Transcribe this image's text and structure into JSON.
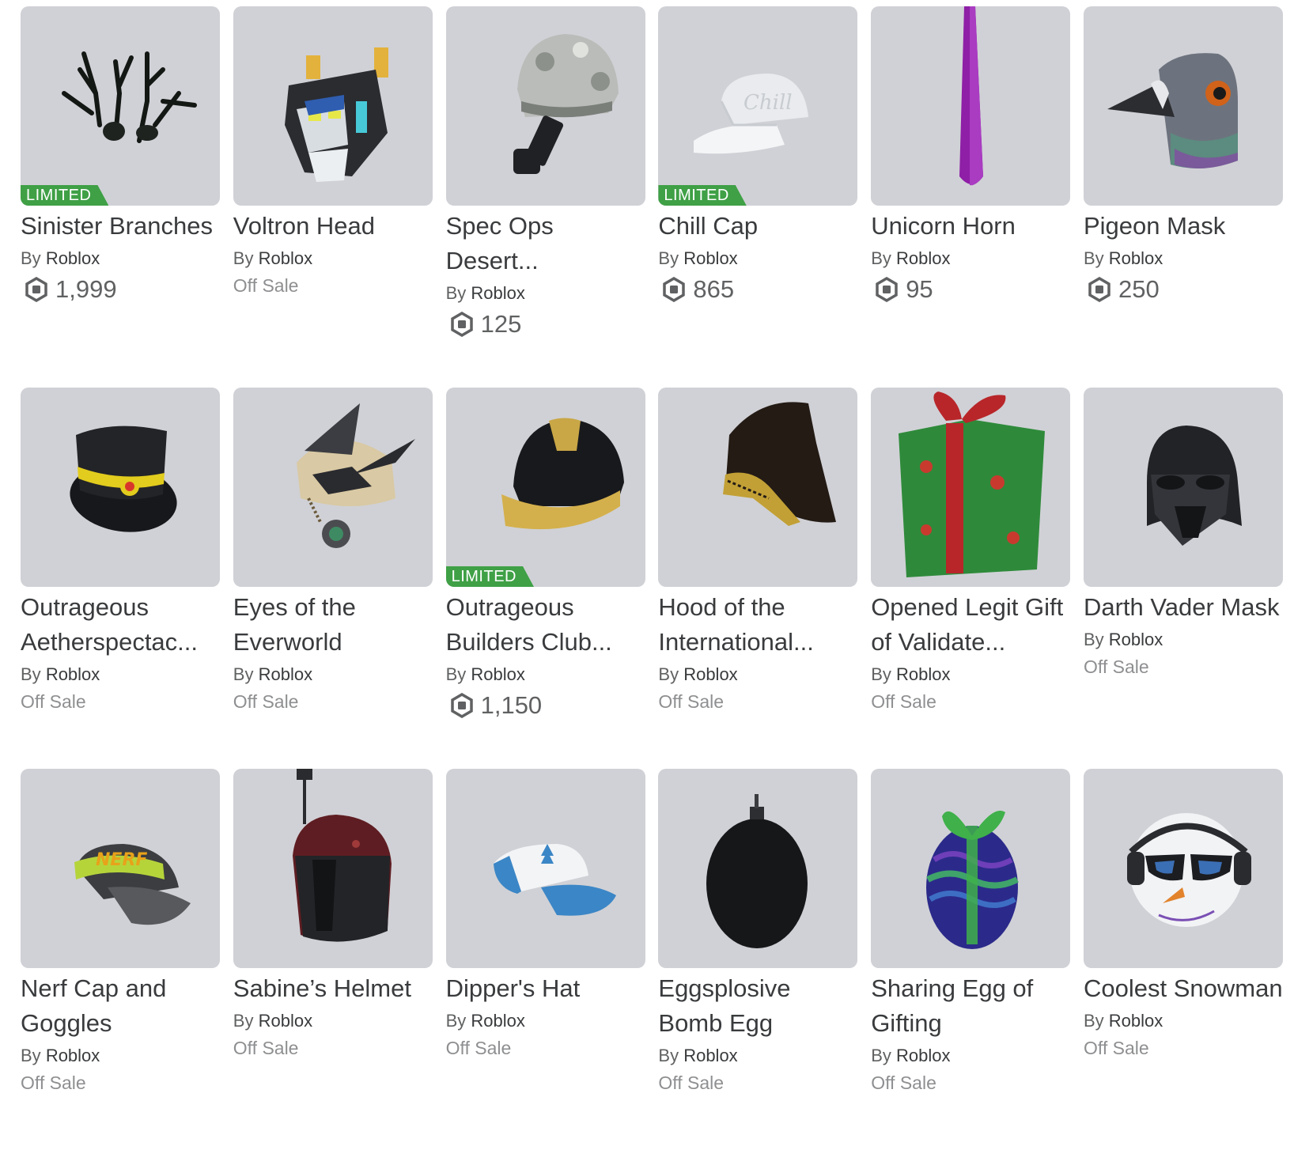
{
  "items": [
    {
      "name": "Sinister Branches",
      "limited": "LIMITED",
      "by": "By",
      "creator": "Roblox",
      "price": "1,999",
      "offsale": null,
      "icon": "branches-icon"
    },
    {
      "name": "Voltron Head",
      "limited": null,
      "by": "By",
      "creator": "Roblox",
      "price": null,
      "offsale": "Off Sale",
      "icon": "robot-head-icon"
    },
    {
      "name": "Spec Ops Desert...",
      "limited": null,
      "by": "By",
      "creator": "Roblox",
      "price": "125",
      "offsale": null,
      "icon": "helmet-icon"
    },
    {
      "name": "Chill Cap",
      "limited": "LIMITED",
      "by": "By",
      "creator": "Roblox",
      "price": "865",
      "offsale": null,
      "icon": "cap-icon"
    },
    {
      "name": "Unicorn Horn",
      "limited": null,
      "by": "By",
      "creator": "Roblox",
      "price": "95",
      "offsale": null,
      "icon": "horn-icon"
    },
    {
      "name": "Pigeon Mask",
      "limited": null,
      "by": "By",
      "creator": "Roblox",
      "price": "250",
      "offsale": null,
      "icon": "pigeon-icon"
    },
    {
      "name": "Outrageous Aetherspectac...",
      "limited": null,
      "by": "By",
      "creator": "Roblox",
      "price": null,
      "offsale": "Off Sale",
      "icon": "tophat-icon"
    },
    {
      "name": "Eyes of the Everworld",
      "limited": null,
      "by": "By",
      "creator": "Roblox",
      "price": null,
      "offsale": "Off Sale",
      "icon": "goggles-hat-icon"
    },
    {
      "name": "Outrageous Builders Club...",
      "limited": "LIMITED",
      "by": "By",
      "creator": "Roblox",
      "price": "1,150",
      "offsale": null,
      "icon": "hardhat-icon"
    },
    {
      "name": "Hood of the International...",
      "limited": null,
      "by": "By",
      "creator": "Roblox",
      "price": null,
      "offsale": "Off Sale",
      "icon": "hood-icon"
    },
    {
      "name": "Opened Legit Gift of Validate...",
      "limited": null,
      "by": "By",
      "creator": "Roblox",
      "price": null,
      "offsale": "Off Sale",
      "icon": "gift-icon"
    },
    {
      "name": "Darth Vader Mask",
      "limited": null,
      "by": "By",
      "creator": "Roblox",
      "price": null,
      "offsale": "Off Sale",
      "icon": "vader-mask-icon"
    },
    {
      "name": "Nerf Cap and Goggles",
      "limited": null,
      "by": "By",
      "creator": "Roblox",
      "price": null,
      "offsale": "Off Sale",
      "icon": "nerf-cap-icon"
    },
    {
      "name": "Sabine’s Helmet",
      "limited": null,
      "by": "By",
      "creator": "Roblox",
      "price": null,
      "offsale": "Off Sale",
      "icon": "sabine-helmet-icon"
    },
    {
      "name": "Dipper's Hat",
      "limited": null,
      "by": "By",
      "creator": "Roblox",
      "price": null,
      "offsale": "Off Sale",
      "icon": "dipper-hat-icon"
    },
    {
      "name": "Eggsplosive Bomb Egg",
      "limited": null,
      "by": "By",
      "creator": "Roblox",
      "price": null,
      "offsale": "Off Sale",
      "icon": "bomb-egg-icon"
    },
    {
      "name": "Sharing Egg of Gifting",
      "limited": null,
      "by": "By",
      "creator": "Roblox",
      "price": null,
      "offsale": "Off Sale",
      "icon": "gift-egg-icon"
    },
    {
      "name": "Coolest Snowman",
      "limited": null,
      "by": "By",
      "creator": "Roblox",
      "price": null,
      "offsale": "Off Sale",
      "icon": "snowman-icon"
    }
  ],
  "colors": {
    "limited_badge": "#3fa046",
    "thumb_bg": "#d0d1d6",
    "price_text": "#606162",
    "offsale_text": "#8e8f91"
  },
  "currency_icon": "robux-icon"
}
